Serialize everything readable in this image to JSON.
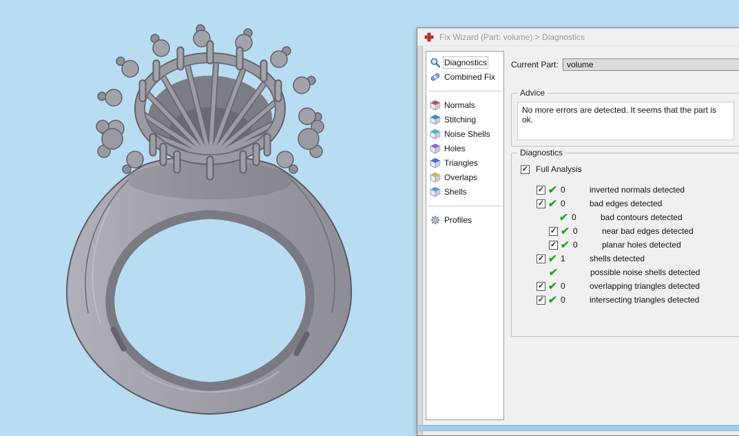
{
  "window": {
    "title": "Fix Wizard (Part: volume) > Diagnostics"
  },
  "colors": {
    "canvas_background": "#b8dcf2",
    "dialog_background": "#f0f0f0",
    "check_green": "#1fa21f",
    "window_icon_red": "#cf2a2a",
    "field_background": "#dcdcdc",
    "bottom_strip_blue": "#a6cfec",
    "ring_gray": "#9a9aa2"
  },
  "sidebar": {
    "items": [
      {
        "label": "Diagnostics",
        "icon": "magnifier-icon",
        "selected": true
      },
      {
        "label": "Combined Fix",
        "icon": "bandage-icon"
      },
      {
        "label": "Normals",
        "icon": "cube-icon",
        "accent": "#cc4b4b"
      },
      {
        "label": "Stitching",
        "icon": "cube-icon",
        "accent": "#4b87cc"
      },
      {
        "label": "Noise Shells",
        "icon": "cube-icon",
        "accent": "#49b6c4"
      },
      {
        "label": "Holes",
        "icon": "cube-icon",
        "accent": "#8f6bd9"
      },
      {
        "label": "Triangles",
        "icon": "cube-icon",
        "accent": "#5668d9"
      },
      {
        "label": "Overlaps",
        "icon": "cube-icon",
        "accent": "#d9b54e"
      },
      {
        "label": "Shells",
        "icon": "cube-icon",
        "accent": "#5f9bd1"
      },
      {
        "label": "Profiles",
        "icon": "gear-icon",
        "accent": "#9aa2ad"
      }
    ]
  },
  "main": {
    "current_part": {
      "label": "Current Part:",
      "value": "volume"
    },
    "advice": {
      "title": "Advice",
      "text": "No more errors are detected. It seems that the part is ok."
    },
    "diagnostics": {
      "title": "Diagnostics",
      "full_analysis": {
        "label": "Full Analysis",
        "checked": true
      },
      "rows": [
        {
          "has_checkbox": true,
          "checked": true,
          "count": "0",
          "label": "inverted normals detected",
          "indent": 0
        },
        {
          "has_checkbox": true,
          "checked": true,
          "count": "0",
          "label": "bad edges detected",
          "indent": 0
        },
        {
          "has_checkbox": false,
          "count": "0",
          "label": "bad contours detected",
          "indent": 2
        },
        {
          "has_checkbox": true,
          "checked": true,
          "count": "0",
          "label": "near bad edges detected",
          "indent": 1
        },
        {
          "has_checkbox": true,
          "checked": true,
          "count": "0",
          "label": "planar holes detected",
          "indent": 1
        },
        {
          "has_checkbox": true,
          "checked": true,
          "count": "1",
          "label": "shells detected",
          "indent": 0
        },
        {
          "has_checkbox": false,
          "count": "",
          "label": "possible noise shells detected",
          "indent": 1
        },
        {
          "has_checkbox": true,
          "checked": true,
          "count": "0",
          "label": "overlapping triangles detected",
          "indent": 0
        },
        {
          "has_checkbox": true,
          "checked": true,
          "count": "0",
          "label": "intersecting triangles detected",
          "indent": 0
        }
      ]
    }
  }
}
